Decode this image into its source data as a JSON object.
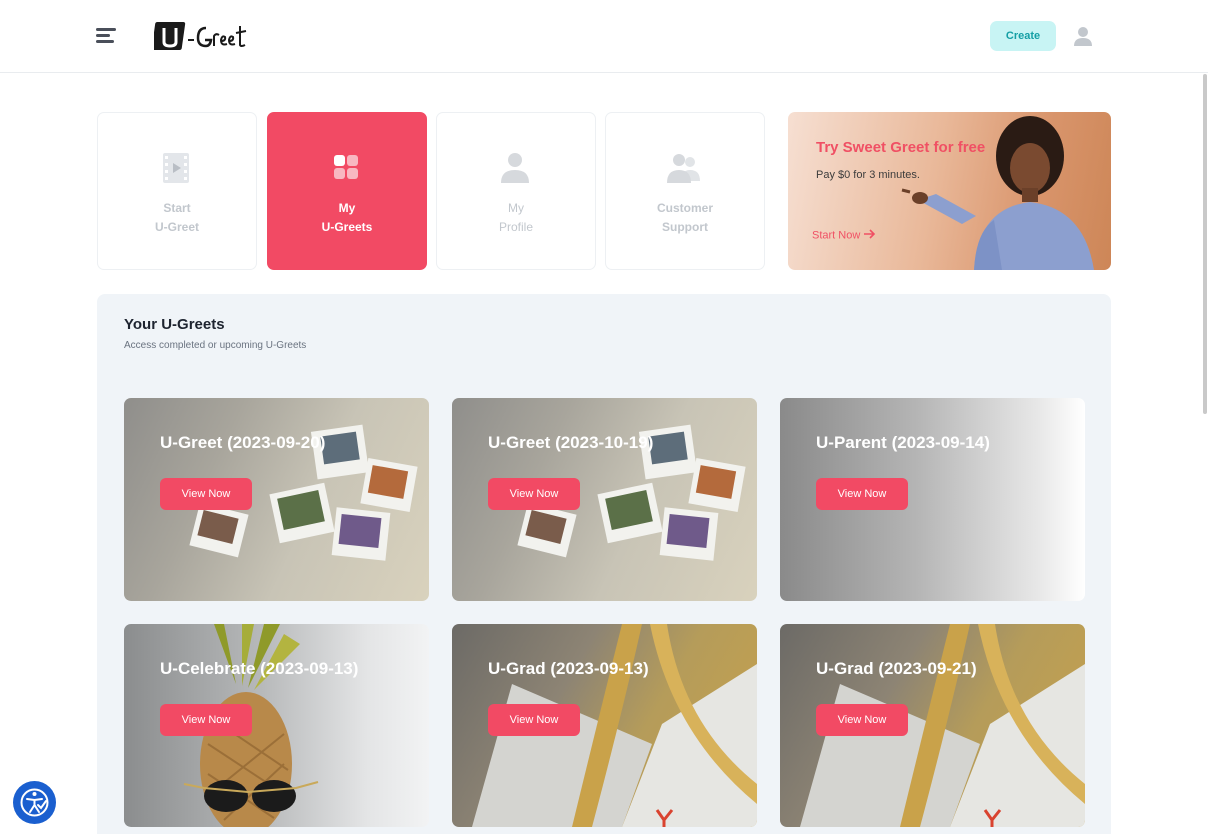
{
  "header": {
    "logo_text": "U-Greet",
    "create_label": "Create"
  },
  "nav": [
    {
      "line1": "Start",
      "line2": "U-Greet",
      "icon": "video-icon",
      "active": false
    },
    {
      "line1": "My",
      "line2": "U-Greets",
      "icon": "grid-icon",
      "active": true
    },
    {
      "line1": "My",
      "line2": "Profile",
      "icon": "user-icon",
      "active": false
    },
    {
      "line1": "Customer",
      "line2": "Support",
      "icon": "users-icon",
      "active": false
    }
  ],
  "promo": {
    "title": "Try Sweet Greet for free",
    "subtitle": "Pay $0 for 3 minutes.",
    "link": "Start Now"
  },
  "section": {
    "title": "Your U-Greets",
    "subtitle": "Access completed or upcoming U-Greets"
  },
  "cards": [
    {
      "title": "U-Greet (2023-09-20)",
      "button": "View Now",
      "bg": "photos"
    },
    {
      "title": "U-Greet (2023-10-19)",
      "button": "View Now",
      "bg": "photos"
    },
    {
      "title": "U-Parent (2023-09-14)",
      "button": "View Now",
      "bg": "grey"
    },
    {
      "title": "U-Celebrate (2023-09-13)",
      "button": "View Now",
      "bg": "pineapple"
    },
    {
      "title": "U-Grad (2023-09-13)",
      "button": "View Now",
      "bg": "gift"
    },
    {
      "title": "U-Grad (2023-09-21)",
      "button": "View Now",
      "bg": "gift"
    }
  ],
  "colors": {
    "accent": "#f24a64",
    "create_bg": "#c8f4f4",
    "create_text": "#159fa5",
    "panel_bg": "#f0f4f8"
  }
}
